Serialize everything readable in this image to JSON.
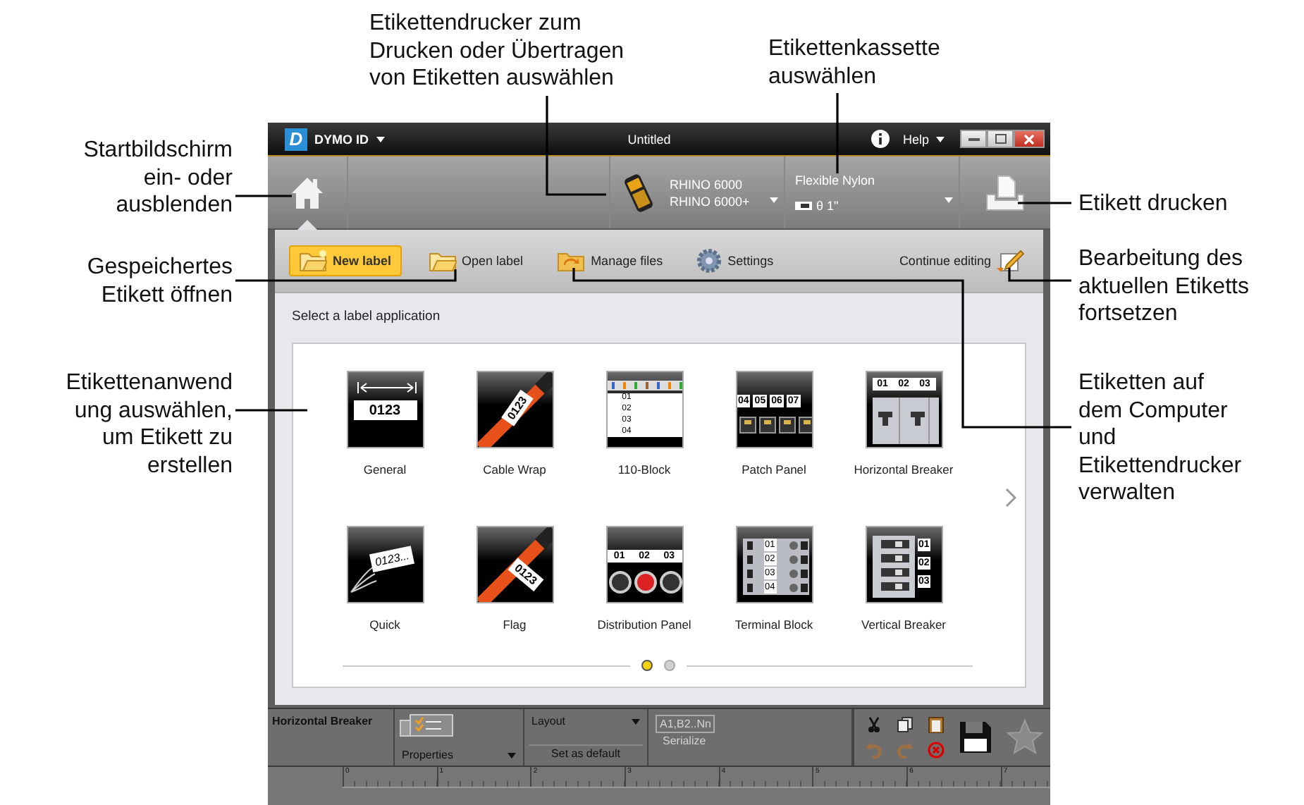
{
  "callouts": [
    {
      "lines": [
        "Etikettendrucker zum",
        "Drucken oder Übertragen",
        "von Etiketten auswählen"
      ]
    },
    {
      "lines": [
        "Etikettenkassette",
        "auswählen"
      ]
    },
    {
      "lines": [
        "Startbildschirm",
        "ein- oder",
        "ausblenden"
      ]
    },
    {
      "lines": [
        "Etikett drucken"
      ]
    },
    {
      "lines": [
        "Gespeichertes",
        "Etikett öffnen"
      ]
    },
    {
      "lines": [
        "Bearbeitung des",
        "aktuellen Etiketts",
        "fortsetzen"
      ]
    },
    {
      "lines": [
        "Etikettenanwend",
        "ung auswählen,",
        "um Etikett zu",
        "erstellen"
      ]
    },
    {
      "lines": [
        "Etiketten auf",
        "dem Computer",
        "und",
        "Etikettendrucker",
        "verwalten"
      ]
    }
  ],
  "window": {
    "logo_letter": "D",
    "app_menu": "DYMO ID",
    "title": "Untitled",
    "help": "Help"
  },
  "toolbar": {
    "printer": [
      "RHINO 6000",
      "RHINO 6000+"
    ],
    "cassette": {
      "name": "Flexible Nylon",
      "size": "θ 1\""
    }
  },
  "nav": {
    "items": [
      {
        "label": "New label",
        "kind": "new",
        "selected": true
      },
      {
        "label": "Open label",
        "kind": "open",
        "selected": false
      },
      {
        "label": "Manage files",
        "kind": "manage",
        "selected": false
      },
      {
        "label": "Settings",
        "kind": "settings",
        "selected": false
      }
    ],
    "continue": "Continue editing"
  },
  "heading": "Select a label application",
  "applications": [
    {
      "label": "General",
      "kind": "general",
      "numbers": [
        "0123"
      ]
    },
    {
      "label": "Cable Wrap",
      "kind": "cable-wrap",
      "numbers": [
        "0123"
      ]
    },
    {
      "label": "110-Block",
      "kind": "block-110",
      "numbers": [
        "01",
        "02",
        "03",
        "04"
      ]
    },
    {
      "label": "Patch Panel",
      "kind": "patch-panel",
      "numbers": [
        "04",
        "05",
        "06",
        "07"
      ]
    },
    {
      "label": "Horizontal Breaker",
      "kind": "horizontal-breaker",
      "numbers": [
        "01",
        "02",
        "03"
      ]
    },
    {
      "label": "Quick",
      "kind": "quick",
      "numbers": [
        "0123..."
      ]
    },
    {
      "label": "Flag",
      "kind": "flag",
      "numbers": [
        "0123"
      ]
    },
    {
      "label": "Distribution Panel",
      "kind": "distribution-panel",
      "numbers": [
        "01",
        "02",
        "03"
      ]
    },
    {
      "label": "Terminal Block",
      "kind": "terminal-block",
      "numbers": [
        "01",
        "02",
        "03",
        "04"
      ]
    },
    {
      "label": "Vertical Breaker",
      "kind": "vertical-breaker",
      "numbers": [
        "01",
        "02",
        "03"
      ]
    }
  ],
  "pager": [
    {
      "selected": true
    },
    {
      "selected": false
    }
  ],
  "bottom": {
    "label_type": "Horizontal Breaker",
    "properties": "Properties",
    "layout": "Layout",
    "set_default": "Set as default",
    "serialize": {
      "sample": "A1,B2..Nn",
      "label": "Serialize",
      "disabled": true
    },
    "ruler": [
      "0",
      "1",
      "2",
      "3",
      "4",
      "5",
      "6",
      "7"
    ]
  }
}
